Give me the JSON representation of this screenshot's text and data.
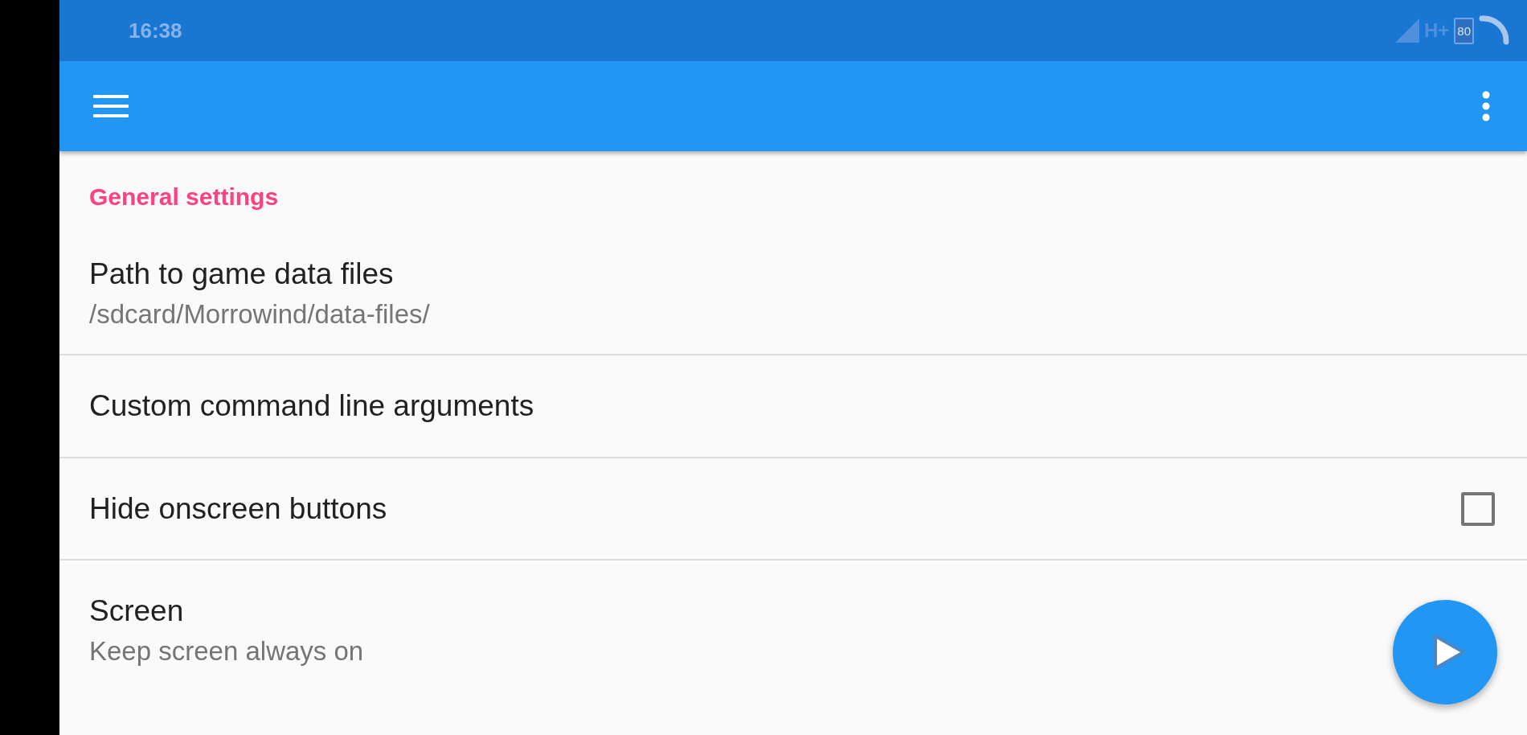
{
  "status_bar": {
    "time": "16:38",
    "network": "H+",
    "battery": "80"
  },
  "section": {
    "title": "General settings"
  },
  "items": [
    {
      "kind": "plain",
      "title": "Path to game data files",
      "subtitle": "/sdcard/Morrowind/data-files/"
    },
    {
      "kind": "plain",
      "title": "Custom command line arguments"
    },
    {
      "kind": "checkbox",
      "title": "Hide onscreen buttons",
      "checked": false
    },
    {
      "kind": "plain",
      "title": "Screen",
      "subtitle": "Keep screen always on"
    }
  ]
}
